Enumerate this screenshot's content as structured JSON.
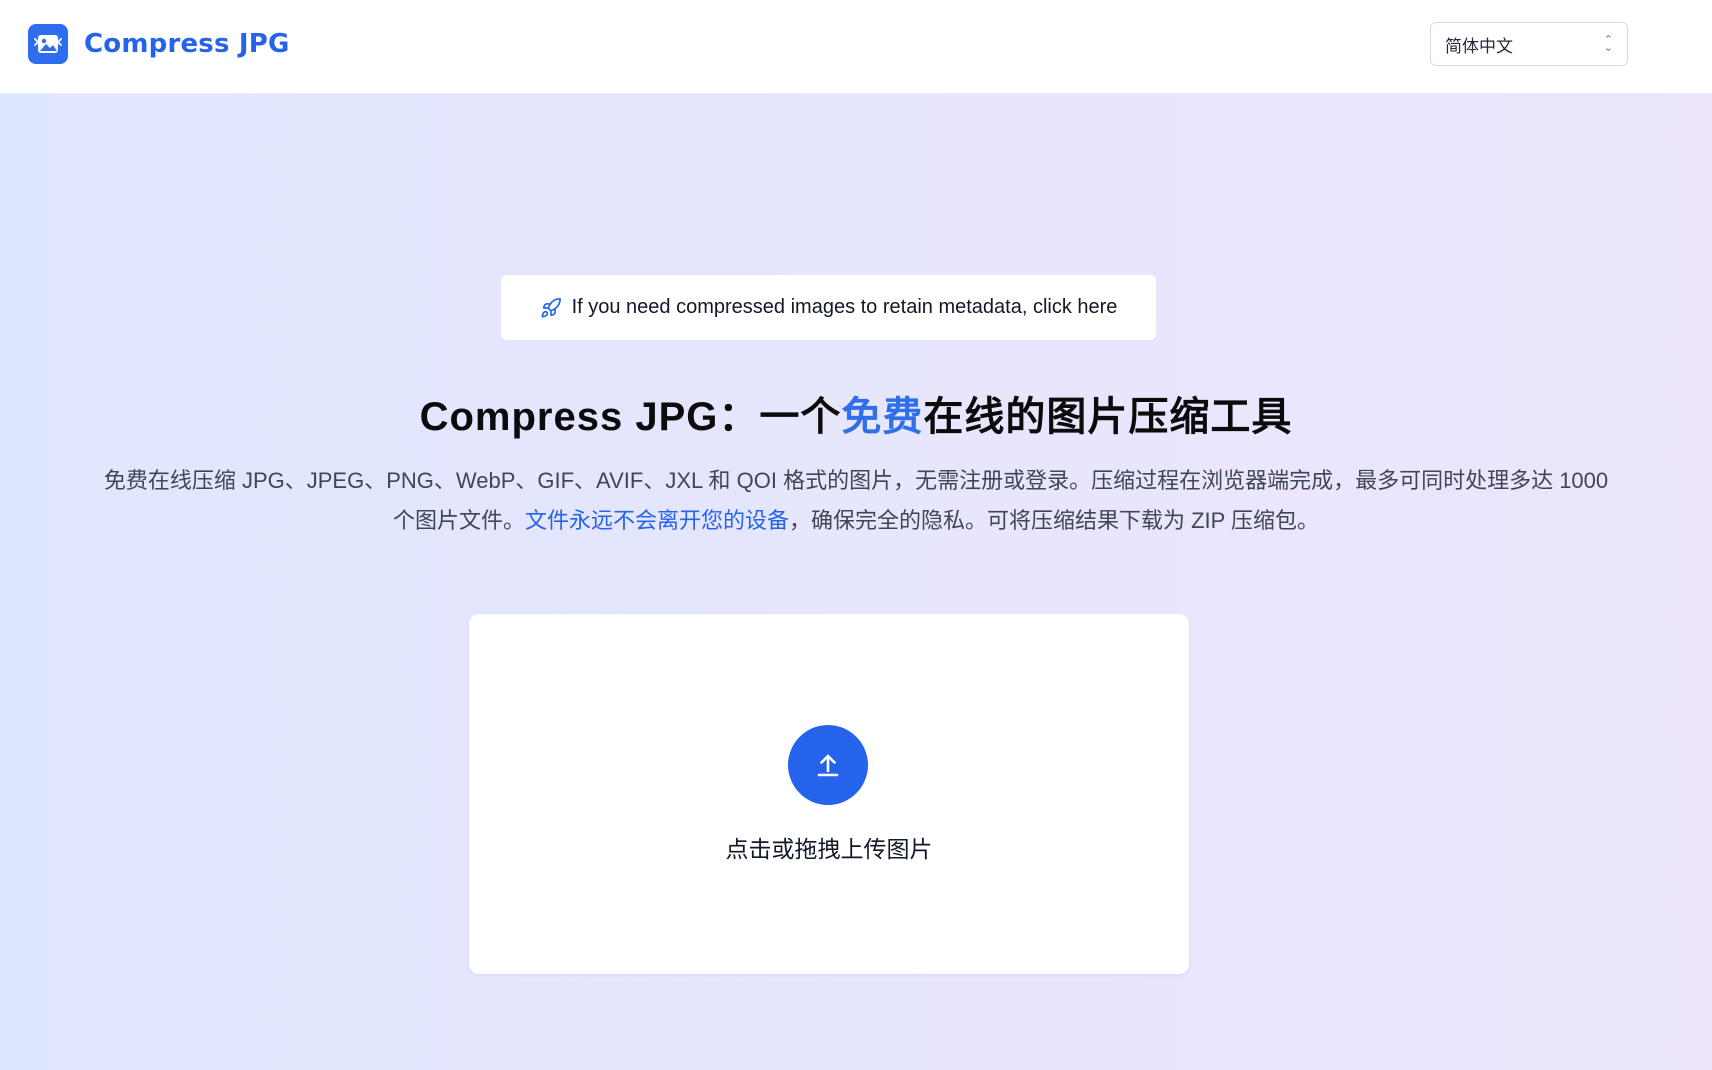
{
  "header": {
    "brand_name": "Compress JPG",
    "logo_icon": "image-compress-logo-icon",
    "language_selected": "简体中文"
  },
  "banner": {
    "icon": "rocket-icon",
    "text": "If you need compressed images to retain metadata, click here"
  },
  "hero": {
    "title_prefix": "Compress JPG：一个",
    "title_highlight": "免费",
    "title_suffix": "在线的图片压缩工具",
    "desc_before_link": "免费在线压缩 JPG、JPEG、PNG、WebP、GIF、AVIF、JXL 和 QOI 格式的图片，无需注册或登录。压缩过程在浏览器端完成，最多可同时处理多达 1000 个图片文件。",
    "desc_link": "文件永远不会离开您的设备",
    "desc_after_link": "，确保完全的隐私。可将压缩结果下载为 ZIP 压缩包。"
  },
  "dropzone": {
    "icon": "upload-arrow-icon",
    "label": "点击或拖拽上传图片"
  },
  "colors": {
    "accent": "#2563eb",
    "background_start": "#dfe7fe",
    "background_end": "#ede6fd"
  }
}
